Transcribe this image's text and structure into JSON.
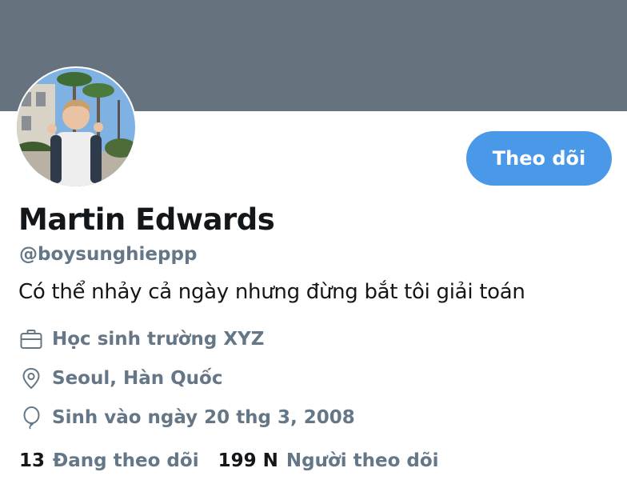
{
  "profile": {
    "banner_color": "#66737f",
    "accent_color": "#4a99e9",
    "name": "Martin Edwards",
    "handle": "@boysunghieppp",
    "bio": "Có thể nhảy cả ngày nhưng đừng bắt tôi giải toán",
    "follow_label": "Theo dõi"
  },
  "meta": {
    "work": {
      "icon": "briefcase-icon",
      "text": "Học sinh trường XYZ"
    },
    "location": {
      "icon": "location-pin-icon",
      "text": "Seoul, Hàn Quốc"
    },
    "birthday": {
      "icon": "balloon-icon",
      "text": "Sinh vào ngày 20 thg 3, 2008"
    }
  },
  "stats": {
    "following_count": "13",
    "following_label": "Đang theo dõi",
    "followers_count": "199 N",
    "followers_label": "Người theo dõi"
  }
}
